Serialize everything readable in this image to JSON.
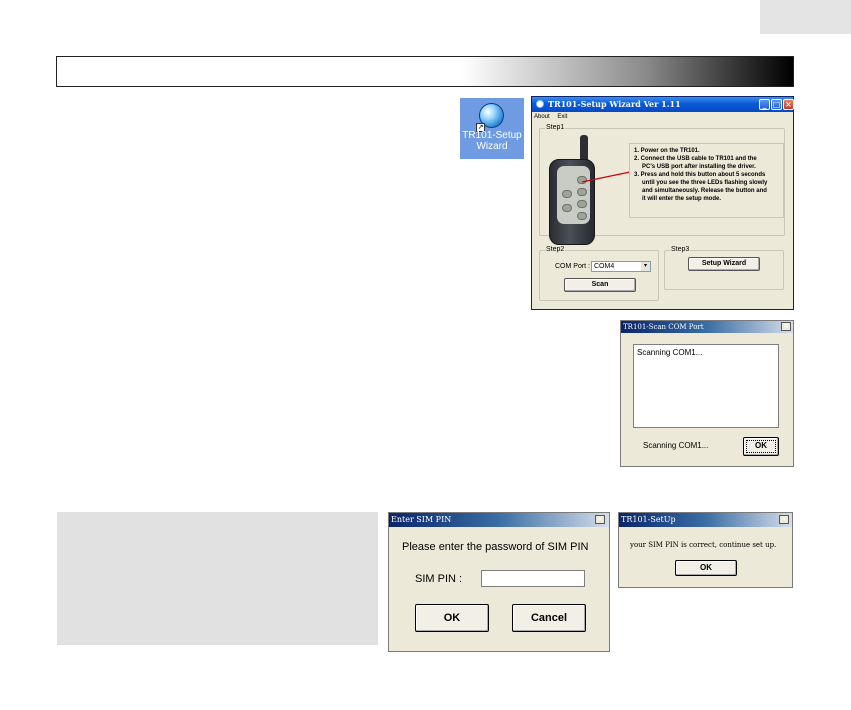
{
  "desktop_icon": {
    "label": "TR101-Setup Wizard"
  },
  "setup_wizard": {
    "title": "TR101-Setup Wizard Ver 1.11",
    "menu": [
      "About",
      "Exit"
    ],
    "step1": {
      "label": "Step1",
      "instructions": [
        "1. Power on the TR101.",
        "2. Connect the USB cable to TR101 and the",
        "PC's USB port after installing the driver.",
        "3. Press and hold this button about 5 seconds",
        "until you see the three LEDs flashing slowly",
        "and simultaneously. Release the button and",
        "it will enter the setup mode."
      ]
    },
    "step2": {
      "label": "Step2",
      "com_port_label": "COM Port :",
      "com_port_value": "COM4",
      "scan_label": "Scan"
    },
    "step3": {
      "label": "Step3",
      "wizard_button": "Setup Wizard"
    }
  },
  "scan_dialog": {
    "title": "TR101-Scan COM Port",
    "list_text": "Scanning COM1...",
    "status_text": "Scanning COM1...",
    "ok_label": "OK"
  },
  "sim_pin_dialog": {
    "title": "Enter SIM PIN",
    "prompt": "Please enter the password of SIM PIN",
    "field_label": "SIM PIN :",
    "field_value": "",
    "ok_label": "OK",
    "cancel_label": "Cancel"
  },
  "setup_dialog": {
    "title": "TR101-SetUp",
    "message": "your SIM PIN is correct, continue set up.",
    "ok_label": "OK"
  },
  "colors": {
    "xp_title": "#0a5ad8",
    "window_bg": "#ece9d8",
    "note_box": "#e2e1e2",
    "lead_line": "#d40000"
  }
}
